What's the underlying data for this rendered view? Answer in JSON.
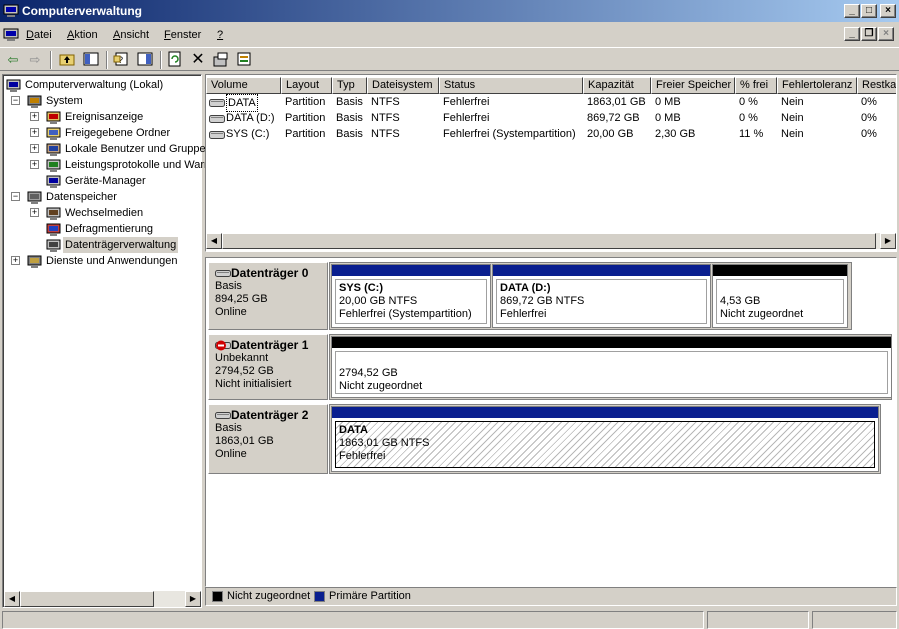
{
  "window": {
    "title": "Computerverwaltung",
    "buttons": {
      "minimize": "_",
      "maximize": "□",
      "close": "×"
    }
  },
  "menu": {
    "items": [
      {
        "key": "D",
        "rest": "atei"
      },
      {
        "key": "A",
        "rest": "ktion"
      },
      {
        "key": "A",
        "rest": "nsicht"
      },
      {
        "key": "F",
        "rest": "enster"
      },
      {
        "key": "?",
        "rest": ""
      }
    ],
    "mdi_buttons": {
      "minimize": "_",
      "restore": "❐",
      "close": "×"
    }
  },
  "toolbar": {
    "icons": [
      "back-arrow-icon",
      "forward-arrow-icon",
      "up-folder-icon",
      "show-tree-icon",
      "properties-icon",
      "help-icon",
      "refresh-icon",
      "delete-icon",
      "export-icon",
      "disk-properties-icon"
    ]
  },
  "tree": {
    "items": [
      {
        "label": "Computerverwaltung (Lokal)",
        "level": 0,
        "expander": "",
        "icon": "computer-icon"
      },
      {
        "label": "System",
        "level": 1,
        "expander": "−",
        "icon": "system-tools-icon"
      },
      {
        "label": "Ereignisanzeige",
        "level": 2,
        "expander": "+",
        "icon": "event-viewer-icon"
      },
      {
        "label": "Freigegebene Ordner",
        "level": 2,
        "expander": "+",
        "icon": "shared-folder-icon"
      },
      {
        "label": "Lokale Benutzer und Gruppen",
        "level": 2,
        "expander": "+",
        "icon": "users-icon"
      },
      {
        "label": "Leistungsprotokolle und Warnungen",
        "level": 2,
        "expander": "+",
        "icon": "performance-icon"
      },
      {
        "label": "Geräte-Manager",
        "level": 2,
        "expander": "",
        "icon": "device-manager-icon"
      },
      {
        "label": "Datenspeicher",
        "level": 1,
        "expander": "−",
        "icon": "storage-icon"
      },
      {
        "label": "Wechselmedien",
        "level": 2,
        "expander": "+",
        "icon": "removable-media-icon"
      },
      {
        "label": "Defragmentierung",
        "level": 2,
        "expander": "",
        "icon": "defrag-icon"
      },
      {
        "label": "Datenträgerverwaltung",
        "level": 2,
        "expander": "",
        "icon": "disk-management-icon",
        "selected": true
      },
      {
        "label": "Dienste und Anwendungen",
        "level": 1,
        "expander": "+",
        "icon": "services-icon"
      }
    ]
  },
  "volumes": {
    "columns": [
      "Volume",
      "Layout",
      "Typ",
      "Dateisystem",
      "Status",
      "Kapazität",
      "Freier Speicher",
      "% frei",
      "Fehlertoleranz",
      "Restkapazität"
    ],
    "rows": [
      [
        "DATA",
        "Partition",
        "Basis",
        "NTFS",
        "Fehlerfrei",
        "1863,01 GB",
        "0 MB",
        "0 %",
        "Nein",
        "0%"
      ],
      [
        "DATA (D:)",
        "Partition",
        "Basis",
        "NTFS",
        "Fehlerfrei",
        "869,72 GB",
        "0 MB",
        "0 %",
        "Nein",
        "0%"
      ],
      [
        "SYS (C:)",
        "Partition",
        "Basis",
        "NTFS",
        "Fehlerfrei (Systempartition)",
        "20,00 GB",
        "2,30 GB",
        "11 %",
        "Nein",
        "0%"
      ]
    ]
  },
  "disks": [
    {
      "name": "Datenträger 0",
      "type": "Basis",
      "size": "894,25 GB",
      "status": "Online",
      "partitions": [
        {
          "name": "SYS  (C:)",
          "size": "20,00 GB NTFS",
          "status": "Fehlerfrei (Systempartition)",
          "kind": "primary"
        },
        {
          "name": "DATA  (D:)",
          "size": "869,72 GB NTFS",
          "status": "Fehlerfrei",
          "kind": "primary"
        },
        {
          "name": "",
          "size": "4,53 GB",
          "status": "Nicht zugeordnet",
          "kind": "unallocated"
        }
      ]
    },
    {
      "name": "Datenträger 1",
      "type": "Unbekannt",
      "size": "2794,52 GB",
      "status": "Nicht initialisiert",
      "partitions": [
        {
          "name": "",
          "size": "2794,52 GB",
          "status": "Nicht zugeordnet",
          "kind": "unallocated"
        }
      ]
    },
    {
      "name": "Datenträger 2",
      "type": "Basis",
      "size": "1863,01 GB",
      "status": "Online",
      "partitions": [
        {
          "name": "DATA",
          "size": "1863,01 GB NTFS",
          "status": "Fehlerfrei",
          "kind": "primary",
          "selected": true
        }
      ]
    }
  ],
  "legend": [
    {
      "label": "Nicht zugeordnet",
      "color": "#000000"
    },
    {
      "label": "Primäre Partition",
      "color": "#0a1f8f"
    }
  ],
  "colors": {
    "primary": "#0a1f8f",
    "unallocated": "#000000",
    "titlebar_start": "#0a246a",
    "titlebar_end": "#a6caf0"
  }
}
